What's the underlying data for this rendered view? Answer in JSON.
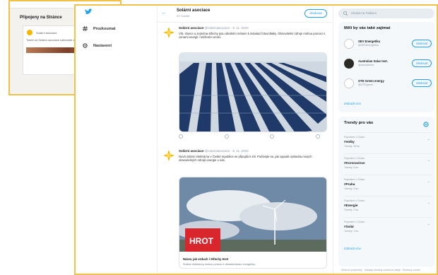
{
  "background_window": {
    "title": "Připojeny na Stránce",
    "card_text": "Solární asociace",
    "card_sub": "Tweet od Solární asociace naleznete zde"
  },
  "nav": {
    "items": [
      {
        "label": "Prozkoumat",
        "icon": "hashtag-icon"
      },
      {
        "label": "Nastavení",
        "icon": "gear-icon"
      }
    ]
  },
  "profile": {
    "name": "Solární asociace",
    "tweet_count": "93 Tweetů",
    "follow_label": "Sledovat"
  },
  "tweets": [
    {
      "author": "Solární asociace",
      "handle": "@solarniasociace · 9. 11. 2020",
      "text": "Vítr, slunce a zejména střechy jsou ideálním místem k instalaci fotovoltaiky. Obnovitelné zdroje mohou pomoci s cenami energií i snížením emisí."
    },
    {
      "author": "Solární asociace",
      "handle": "@solarniasociace · 6. 11. 2020",
      "text": "Nová solární elektrárna v České republice se připojila k síti. Podívejte se, jak vypadá výstavba nových obnovitelných zdrojů energie u nás."
    }
  ],
  "media": {
    "card_title": "Název, jak vzduch i Střechy Hrot",
    "card_desc": "Solární elektrárny mohou pomoci s dekarbonizací energetiky.",
    "logo_text": "HROT"
  },
  "search": {
    "placeholder": "Hledat na Twitteru"
  },
  "suggestions": {
    "title": "Měli by vás také zajímat",
    "items": [
      {
        "name": "SEV Energetika",
        "handle": "@SEVenergetika",
        "button": "Sledovat"
      },
      {
        "name": "Australian Solar Inst.",
        "handle": "@ausolarinst",
        "button": "Sledovat"
      },
      {
        "name": "OTE Green energy",
        "handle": "@OTEgreen",
        "button": "Sledovat"
      }
    ],
    "more": "Zobrazit více"
  },
  "trends": {
    "title": "Trendy pro vás",
    "items": [
      {
        "context": "Populární v Česku",
        "name": "#Volby",
        "count": "Tweety: 15 tis."
      },
      {
        "context": "Populární v Česku",
        "name": "#Koronavirus",
        "count": "Tweety: 8 tis."
      },
      {
        "context": "Populární v Česku",
        "name": "#Praha",
        "count": "Tweety: 3 tis."
      },
      {
        "context": "Populární v Česku",
        "name": "#Energie",
        "count": "Tweety: 2 tis."
      },
      {
        "context": "Populární v Česku",
        "name": "#Solár",
        "count": "Tweety: 1 tis."
      }
    ],
    "more": "Zobrazit více"
  },
  "footer": "Smluvní podmínky · Zásady ochrany osobních údajů · Soubory cookie",
  "colors": {
    "accent": "#1da1f2",
    "frame": "#f2c14a"
  }
}
